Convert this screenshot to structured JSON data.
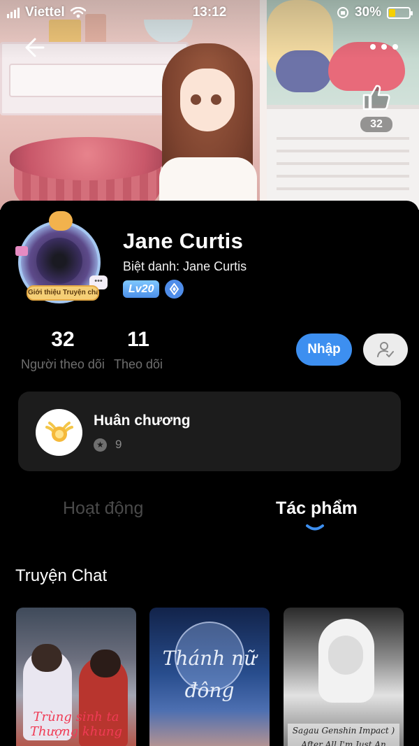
{
  "status_bar": {
    "carrier": "Viettel",
    "time": "13:12",
    "battery": "30%",
    "battery_level": 0.3
  },
  "header": {
    "like_count": "32"
  },
  "profile": {
    "name": "Jane Curtis",
    "nickname": "Biệt danh: Jane Curtis",
    "level": "Lv20",
    "avatar_banner": "Giới thiệu Truyện chat",
    "avatar_chat_glyph": "•••"
  },
  "stats": [
    {
      "value": "32",
      "label": "Người theo dõi"
    },
    {
      "value": "11",
      "label": "Theo dõi"
    }
  ],
  "actions": {
    "join_label": "Nhập"
  },
  "medal": {
    "title": "Huân chương",
    "count": "9"
  },
  "tabs": [
    {
      "label": "Hoạt động",
      "active": false
    },
    {
      "label": "Tác phẩm",
      "active": true
    }
  ],
  "works": {
    "section_title": "Truyện Chat",
    "cards": [
      {
        "title": "Trùng sinh ta Thượng khung"
      },
      {
        "title": "Thánh nữ đông"
      },
      {
        "title": "Sagau Genshin Impact ) After All I'm Just An Useless"
      }
    ]
  },
  "colors": {
    "accent": "#3d8ff0",
    "background": "#000000",
    "card": "#1c1c1c",
    "muted_text": "#6f6f6f"
  }
}
